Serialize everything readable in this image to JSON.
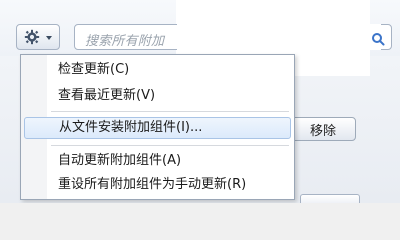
{
  "toolbar": {
    "gear_button_icon": "gear-icon",
    "search_placeholder": "搜索所有附加",
    "search_icon": "search-icon"
  },
  "underlying": {
    "remove_button_label": "移除"
  },
  "menu": {
    "items": [
      {
        "label": "检查更新(C)"
      },
      {
        "label": "查看最近更新(V)"
      },
      {
        "label": "从文件安装附加组件(I)..."
      },
      {
        "label": "自动更新附加组件(A)"
      },
      {
        "label": "重设所有附加组件为手动更新(R)"
      }
    ]
  }
}
